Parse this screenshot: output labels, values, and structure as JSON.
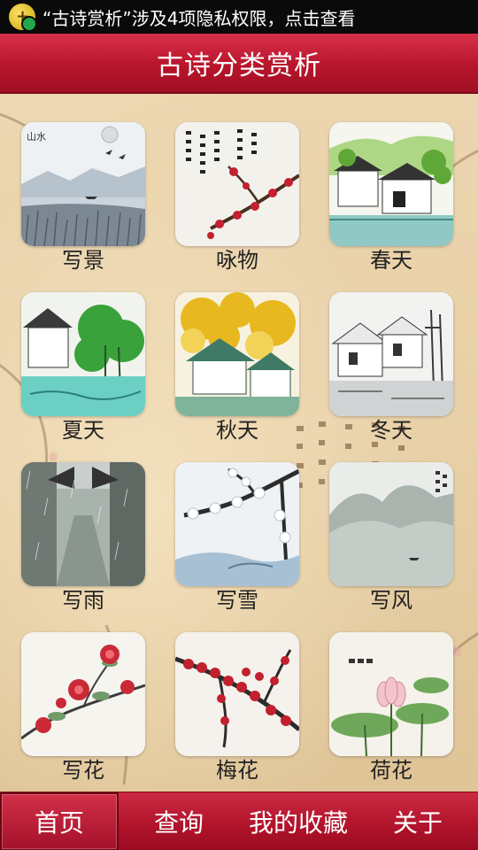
{
  "status_bar": {
    "notification_text": "“古诗赏析”涉及4项隐私权限，点击查看",
    "icon": "security-shield-icon"
  },
  "header": {
    "title": "古诗分类赏析"
  },
  "categories": [
    {
      "label": "写景",
      "icon": "landscape-painting-icon"
    },
    {
      "label": "咏物",
      "icon": "plum-blossom-calligraphy-icon"
    },
    {
      "label": "春天",
      "icon": "spring-village-icon"
    },
    {
      "label": "夏天",
      "icon": "summer-village-icon"
    },
    {
      "label": "秋天",
      "icon": "autumn-village-icon"
    },
    {
      "label": "冬天",
      "icon": "winter-village-icon"
    },
    {
      "label": "写雨",
      "icon": "rainy-alley-icon"
    },
    {
      "label": "写雪",
      "icon": "snowy-branch-icon"
    },
    {
      "label": "写风",
      "icon": "misty-mountain-icon"
    },
    {
      "label": "写花",
      "icon": "red-flowers-icon"
    },
    {
      "label": "梅花",
      "icon": "plum-blossom-icon"
    },
    {
      "label": "荷花",
      "icon": "lotus-icon"
    }
  ],
  "tabs": [
    {
      "label": "首页",
      "active": true
    },
    {
      "label": "查询",
      "active": false
    },
    {
      "label": "我的收藏",
      "active": false
    },
    {
      "label": "关于",
      "active": false
    }
  ],
  "colors": {
    "accent": "#b8152b",
    "status_bar": "#0a0a0a",
    "background": "#e6cfa6"
  }
}
